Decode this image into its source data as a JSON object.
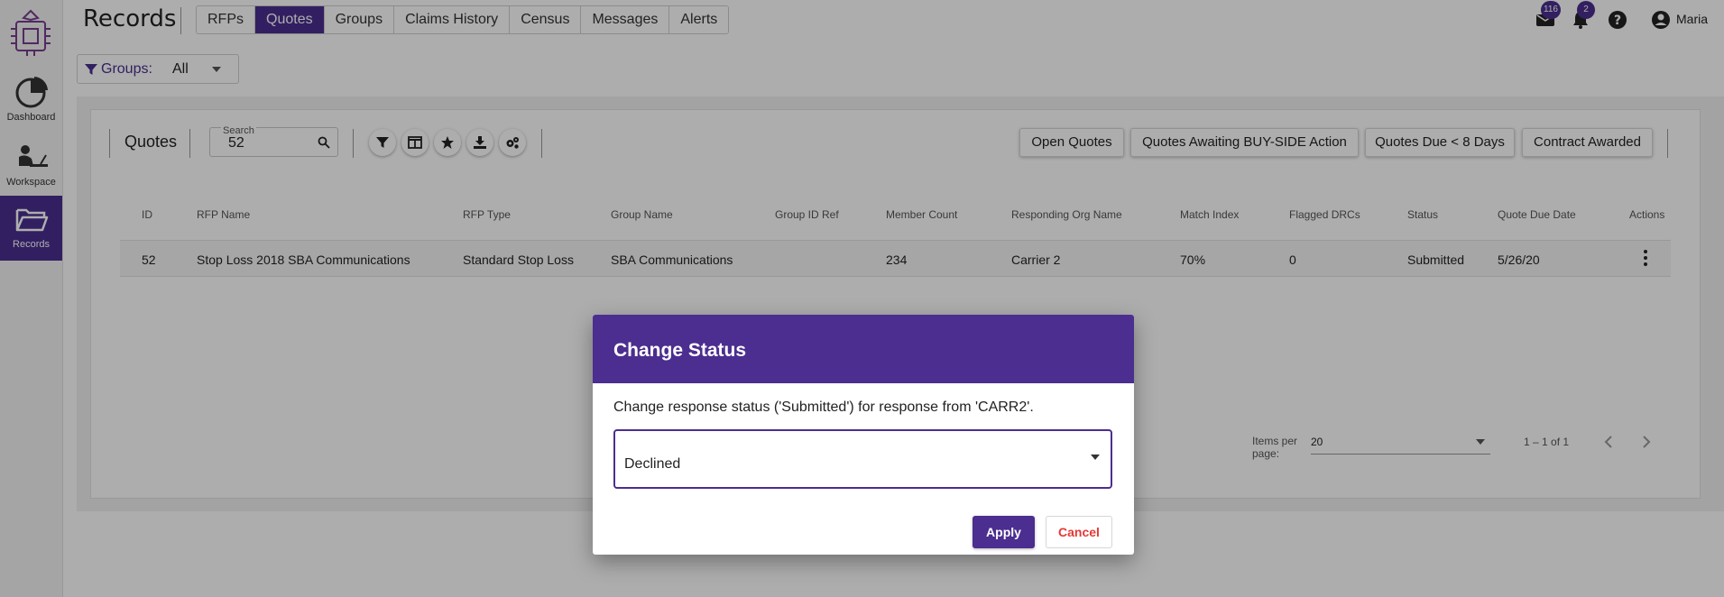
{
  "app": {
    "title": "Records",
    "user": "Maria"
  },
  "colors": {
    "brand": "#4b2e8f",
    "cancel": "#e53935"
  },
  "sidebar": {
    "items": [
      {
        "label": "Dashboard",
        "icon": "pie-chart-icon"
      },
      {
        "label": "Workspace",
        "icon": "person-laptop-icon"
      },
      {
        "label": "Records",
        "icon": "folder-open-icon",
        "active": true
      }
    ]
  },
  "header": {
    "tabs": [
      "RFPs",
      "Quotes",
      "Groups",
      "Claims History",
      "Census",
      "Messages",
      "Alerts"
    ],
    "active_tab": "Quotes",
    "mail_count": "116",
    "alerts_count": "2"
  },
  "groups_filter": {
    "label": "Groups:",
    "value": "All"
  },
  "toolbar": {
    "title": "Quotes",
    "search_caption": "Search",
    "search_value": "52",
    "icons": [
      "filter-icon",
      "columns-icon",
      "star-icon",
      "download-icon",
      "settings-icon"
    ],
    "quick_filters": [
      "Open Quotes",
      "Quotes Awaiting BUY-SIDE Action",
      "Quotes Due < 8 Days",
      "Contract Awarded"
    ]
  },
  "table": {
    "headers": [
      "ID",
      "RFP Name",
      "RFP Type",
      "Group Name",
      "Group ID Ref",
      "Member Count",
      "Responding Org Name",
      "Match Index",
      "Flagged DRCs",
      "Status",
      "Quote Due Date",
      "Actions"
    ],
    "rows": [
      [
        "52",
        "Stop Loss 2018 SBA Communications",
        "Standard Stop Loss",
        "SBA Communications",
        "",
        "234",
        "Carrier 2",
        "70%",
        "0",
        "Submitted",
        "5/26/20"
      ]
    ]
  },
  "pagination": {
    "items_per_page_label": "Items per page:",
    "items_per_page": "20",
    "range": "1 – 1 of 1"
  },
  "dialog": {
    "title": "Change Status",
    "message": "Change response status ('Submitted') for response from 'CARR2'.",
    "selected": "Declined",
    "apply": "Apply",
    "cancel": "Cancel"
  }
}
